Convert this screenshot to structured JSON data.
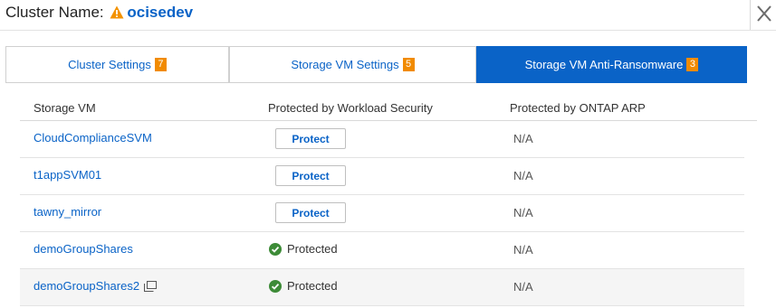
{
  "header": {
    "label": "Cluster Name:",
    "cluster_name": "ocisedev",
    "warning_icon": "warning-triangle-icon",
    "close_icon": "close-icon"
  },
  "tabs": [
    {
      "label": "Cluster Settings",
      "count": "7",
      "active": false
    },
    {
      "label": "Storage VM Settings",
      "count": "5",
      "active": false
    },
    {
      "label": "Storage VM Anti-Ransomware",
      "count": "3",
      "active": true
    }
  ],
  "table": {
    "columns": [
      "Storage VM",
      "Protected by Workload Security",
      "Protected by ONTAP ARP"
    ],
    "rows": [
      {
        "storage_vm": "CloudComplianceSVM",
        "workload_security": "Protect",
        "arp": "N/A"
      },
      {
        "storage_vm": "t1appSVM01",
        "workload_security": "Protect",
        "arp": "N/A"
      },
      {
        "storage_vm": "tawny_mirror",
        "workload_security": "Protect",
        "arp": "N/A"
      },
      {
        "storage_vm": "demoGroupShares",
        "workload_security": "Protected",
        "arp": "N/A"
      },
      {
        "storage_vm": "demoGroupShares2",
        "workload_security": "Protected",
        "arp": "N/A"
      }
    ]
  },
  "colors": {
    "accent": "#0a63c7",
    "badge": "#f18b00",
    "success": "#3d8b37",
    "warning": "#f39200"
  }
}
